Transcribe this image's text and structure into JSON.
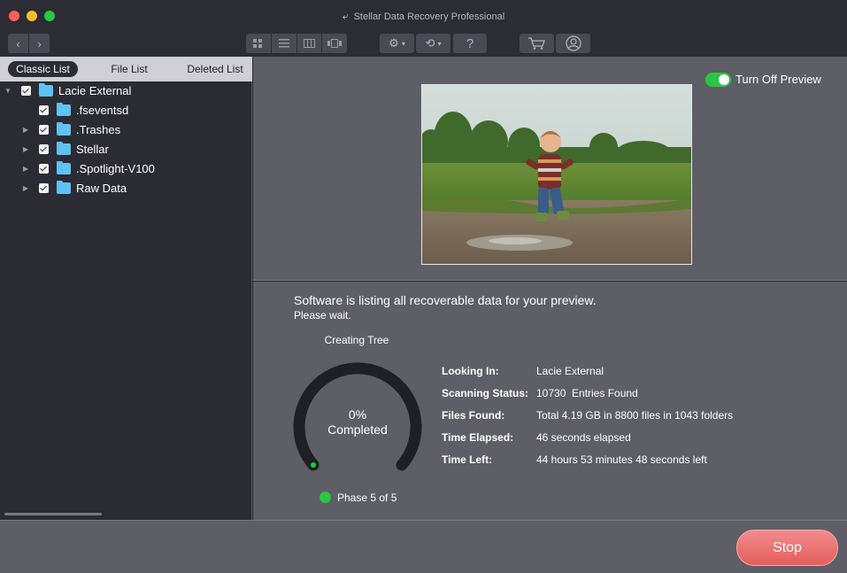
{
  "window": {
    "title": "Stellar Data Recovery Professional",
    "back_icon": "undo-arrow-icon"
  },
  "toolbar": {
    "nav_back_icon": "chevron-left-icon",
    "nav_forward_icon": "chevron-right-icon",
    "view_icons": [
      "grid-view-icon",
      "list-view-icon",
      "column-view-icon",
      "coverflow-view-icon"
    ],
    "settings_icon": "gear-icon",
    "history_icon": "history-icon",
    "help_label": "?",
    "cart_icon": "cart-icon",
    "user_icon": "user-icon"
  },
  "sidebar": {
    "tabs": [
      {
        "label": "Classic List",
        "active": true
      },
      {
        "label": "File List",
        "active": false
      },
      {
        "label": "Deleted List",
        "active": false
      }
    ],
    "tree": {
      "root": {
        "label": "Lacie External",
        "checked": true,
        "expanded": true
      },
      "children": [
        {
          "label": ".fseventsd",
          "checked": true,
          "expandable": false
        },
        {
          "label": ".Trashes",
          "checked": true,
          "expandable": true
        },
        {
          "label": "Stellar",
          "checked": true,
          "expandable": true
        },
        {
          "label": ".Spotlight-V100",
          "checked": true,
          "expandable": true
        },
        {
          "label": "Raw Data",
          "checked": true,
          "expandable": true
        }
      ]
    }
  },
  "preview": {
    "toggle_label": "Turn Off Preview",
    "toggle_on": true
  },
  "scan": {
    "headline": "Software is listing all recoverable data for your preview.",
    "subline": "Please wait.",
    "stage_label": "Creating Tree",
    "percent": "0%",
    "percent_caption": "Completed",
    "progress_fraction": 0.0,
    "phase_label": "Phase 5 of 5",
    "info": [
      {
        "key": "Looking In:",
        "value": "Lacie External"
      },
      {
        "key": "Scanning Status:",
        "value": "10730  Entries Found"
      },
      {
        "key": "Files Found:",
        "value": "Total 4.19 GB in 8800 files in 1043 folders"
      },
      {
        "key": "Time Elapsed:",
        "value": "46 seconds elapsed"
      },
      {
        "key": "Time Left:",
        "value": "44 hours 53 minutes 48 seconds left"
      }
    ]
  },
  "footer": {
    "stop_label": "Stop"
  },
  "colors": {
    "accent_green": "#28c840",
    "stop_red": "#e45e5c",
    "folder_blue": "#5ec2f3"
  }
}
